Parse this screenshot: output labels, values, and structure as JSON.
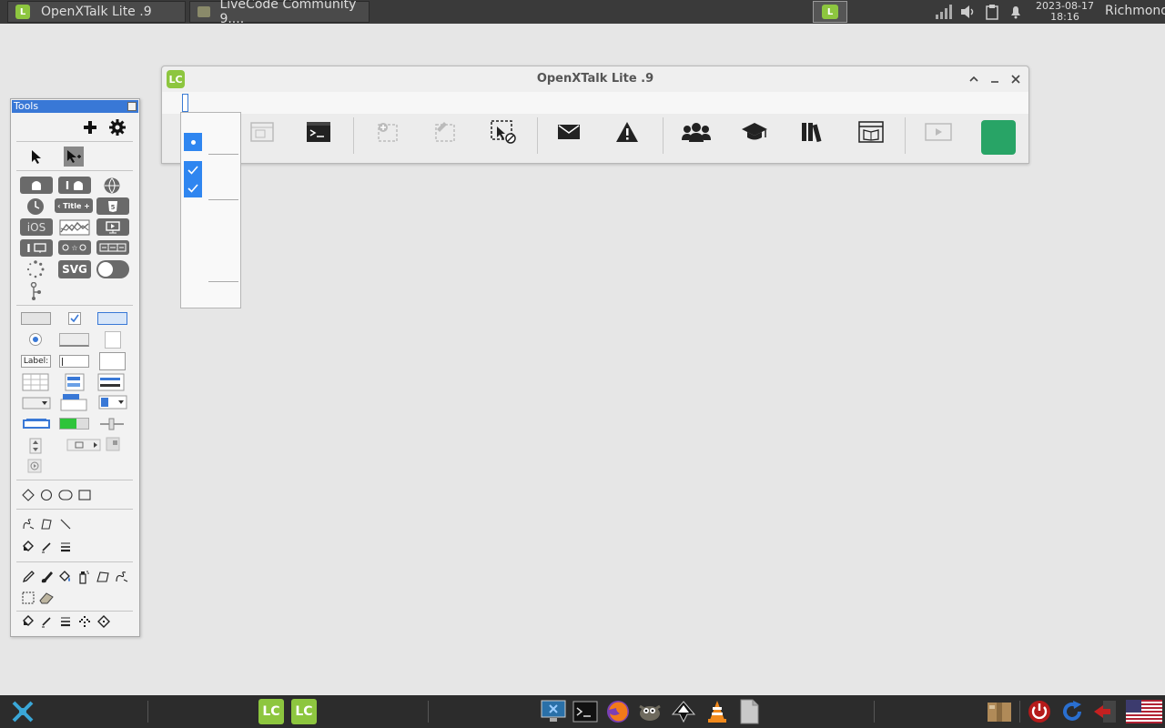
{
  "taskbar": {
    "tasks": [
      {
        "label": "OpenXTalk Lite .9"
      },
      {
        "label": "LiveCode Community 9...."
      }
    ],
    "clock": {
      "date": "2023-08-17",
      "time": "18:16"
    },
    "username": "Richmond"
  },
  "window": {
    "title": "OpenXTalk Lite .9",
    "logo_text": "LC"
  },
  "tools_palette": {
    "title": "Tools",
    "widget_labels": {
      "title_widget": "‹ Title +",
      "ios": "iOS",
      "svg": "SVG",
      "label_field": "Label:"
    }
  },
  "colors": {
    "accent": "#2f86f0",
    "green_button": "#28a466",
    "palette_title": "#3978d6",
    "top_panel": "#3a3a3a",
    "dock": "#2c2c2c",
    "lc_green": "#8dc63f"
  }
}
